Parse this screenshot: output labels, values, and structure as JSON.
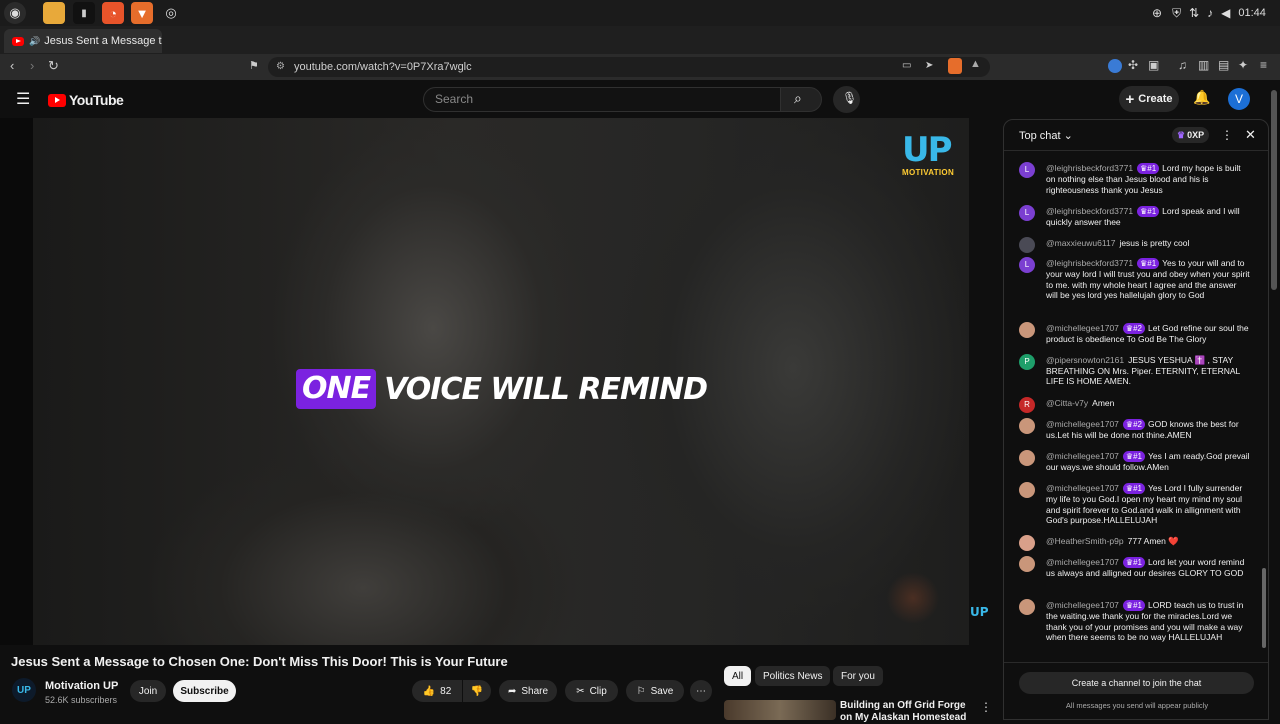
{
  "os": {
    "time": "01:44"
  },
  "browser": {
    "tab_title": "Jesus Sent a Message to C",
    "url": "youtube.com/watch?v=0P7Xra7wglc"
  },
  "youtube": {
    "logo_text": "YouTube",
    "search_placeholder": "Search",
    "create_label": "Create",
    "avatar_letter": "V"
  },
  "video": {
    "caption_highlight": "ONE",
    "caption_rest": "VOICE WILL REMIND",
    "watermark_big": "UP",
    "watermark_small": "MOTIVATION",
    "watermark_corner": "UP",
    "title": "Jesus Sent a Message to Chosen One: Don't Miss This Door! This is Your Future"
  },
  "channel": {
    "logo_text": "UP",
    "name": "Motivation UP",
    "subscribers": "52.6K subscribers",
    "join_label": "Join",
    "subscribe_label": "Subscribe"
  },
  "actions": {
    "like_count": "82",
    "share_label": "Share",
    "clip_label": "Clip",
    "save_label": "Save"
  },
  "chips": [
    "All",
    "Politics News",
    "For you"
  ],
  "recommendation": {
    "title": "Building an Off Grid Forge on My Alaskan Homestead"
  },
  "chat": {
    "header": "Top chat",
    "points_label": "0XP",
    "join_label": "Create a channel to join the chat",
    "public_note": "All messages you send will appear publicly",
    "messages": [
      {
        "avatar": "L",
        "color": "#7b3fd1",
        "author": "@leighrisbeckford3771",
        "badge": "♛#1",
        "text": "Lord my hope is built on nothing else than Jesus blood and his is righteousness thank you Jesus"
      },
      {
        "avatar": "L",
        "color": "#7b3fd1",
        "author": "@leighrisbeckford3771",
        "badge": "♛#1",
        "text": "Lord speak and I will quickly answer thee"
      },
      {
        "avatar": "",
        "color": "#4a4a55",
        "author": "@maxxieuwu6117",
        "badge": "",
        "text": "jesus is pretty cool"
      },
      {
        "avatar": "L",
        "color": "#7b3fd1",
        "author": "@leighrisbeckford3771",
        "badge": "♛#1",
        "text": "Yes to your will and to your way lord I will trust you and obey when your spirit to me. with my whole heart I agree and the answer will be yes lord yes hallelujah glory to God"
      },
      {
        "avatar": "",
        "color": "#c9967a",
        "author": "@michellegee1707",
        "badge": "♛#2",
        "text": "Let God refine our soul the product is obedience To God Be The Glory"
      },
      {
        "avatar": "P",
        "color": "#1e9e6a",
        "author": "@pipersnowton2161",
        "badge": "",
        "text": "JESUS YESHUA ✝️ , STAY BREATHING ON Mrs. Piper. ETERNITY, ETERNAL LIFE IS HOME AMEN."
      },
      {
        "avatar": "R",
        "color": "#c62828",
        "author": "@Citta-v7y",
        "badge": "",
        "text": "Amen"
      },
      {
        "avatar": "",
        "color": "#c9967a",
        "author": "@michellegee1707",
        "badge": "♛#2",
        "text": "GOD knows the best for us.Let his will be done not thine.AMEN"
      },
      {
        "avatar": "",
        "color": "#c9967a",
        "author": "@michellegee1707",
        "badge": "♛#1",
        "text": "Yes I am ready.God prevail our ways.we should follow.AMen"
      },
      {
        "avatar": "",
        "color": "#c9967a",
        "author": "@michellegee1707",
        "badge": "♛#1",
        "text": "Yes Lord I fully surrender my life to you God.I open my heart my mind my soul and spirit forever to God.and walk in allignment with God's purpose.HALLELUJAH"
      },
      {
        "avatar": "",
        "color": "#d9a08a",
        "author": "@HeatherSmith-p9p",
        "badge": "",
        "text": "777 Amen ❤️"
      },
      {
        "avatar": "",
        "color": "#c9967a",
        "author": "@michellegee1707",
        "badge": "♛#1",
        "text": "Lord let your word remind us always and alligned our desires GLORY TO GOD"
      },
      {
        "avatar": "",
        "color": "#c9967a",
        "author": "@michellegee1707",
        "badge": "♛#1",
        "text": "LORD teach us to trust in the waiting.we thank you for the miracles.Lord we thank you of your promises and you will make a way when there seems to be no way HALLELUJAH"
      }
    ]
  }
}
